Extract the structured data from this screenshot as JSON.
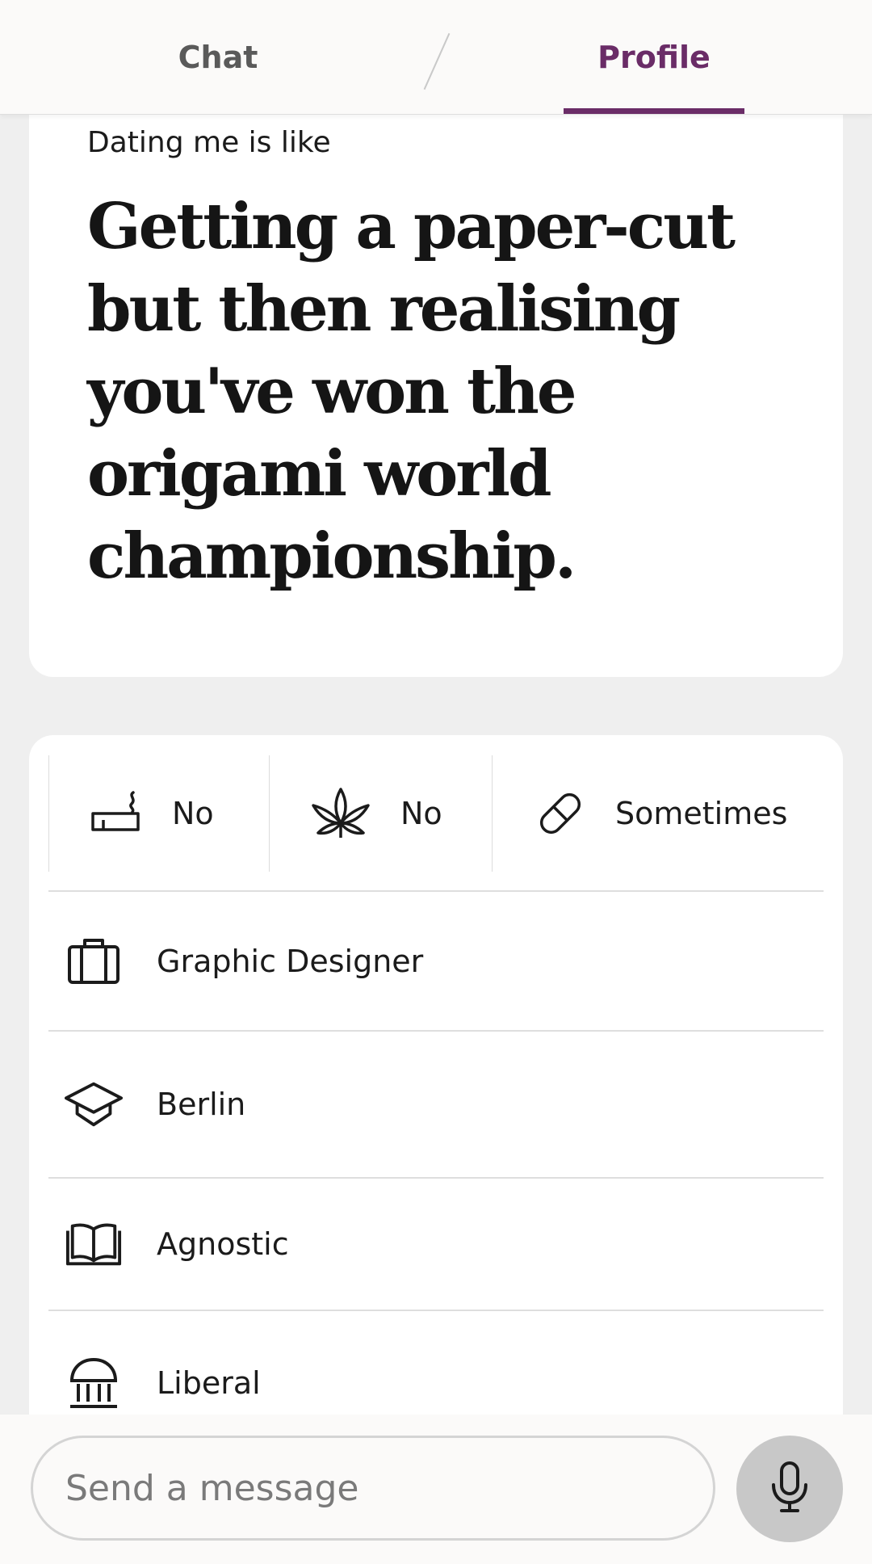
{
  "tabs": {
    "chat": "Chat",
    "profile": "Profile",
    "active": "Profile"
  },
  "prompt": {
    "label": "Dating me is like",
    "answer": "Getting a paper-cut but then realising you've won the origami world championship."
  },
  "vitals": [
    {
      "icon": "cigarette-icon",
      "value": "No"
    },
    {
      "icon": "cannabis-leaf-icon",
      "value": "No"
    },
    {
      "icon": "pill-icon",
      "value": "Sometimes"
    }
  ],
  "details": [
    {
      "icon": "briefcase-icon",
      "value": "Graphic Designer"
    },
    {
      "icon": "graduation-cap-icon",
      "value": "Berlin"
    },
    {
      "icon": "book-icon",
      "value": "Agnostic"
    },
    {
      "icon": "government-building-icon",
      "value": "Liberal"
    }
  ],
  "composer": {
    "placeholder": "Send a message",
    "mic_icon": "microphone-icon"
  },
  "colors": {
    "accent": "#6a2c67",
    "background": "#efefef",
    "card": "#ffffff"
  }
}
